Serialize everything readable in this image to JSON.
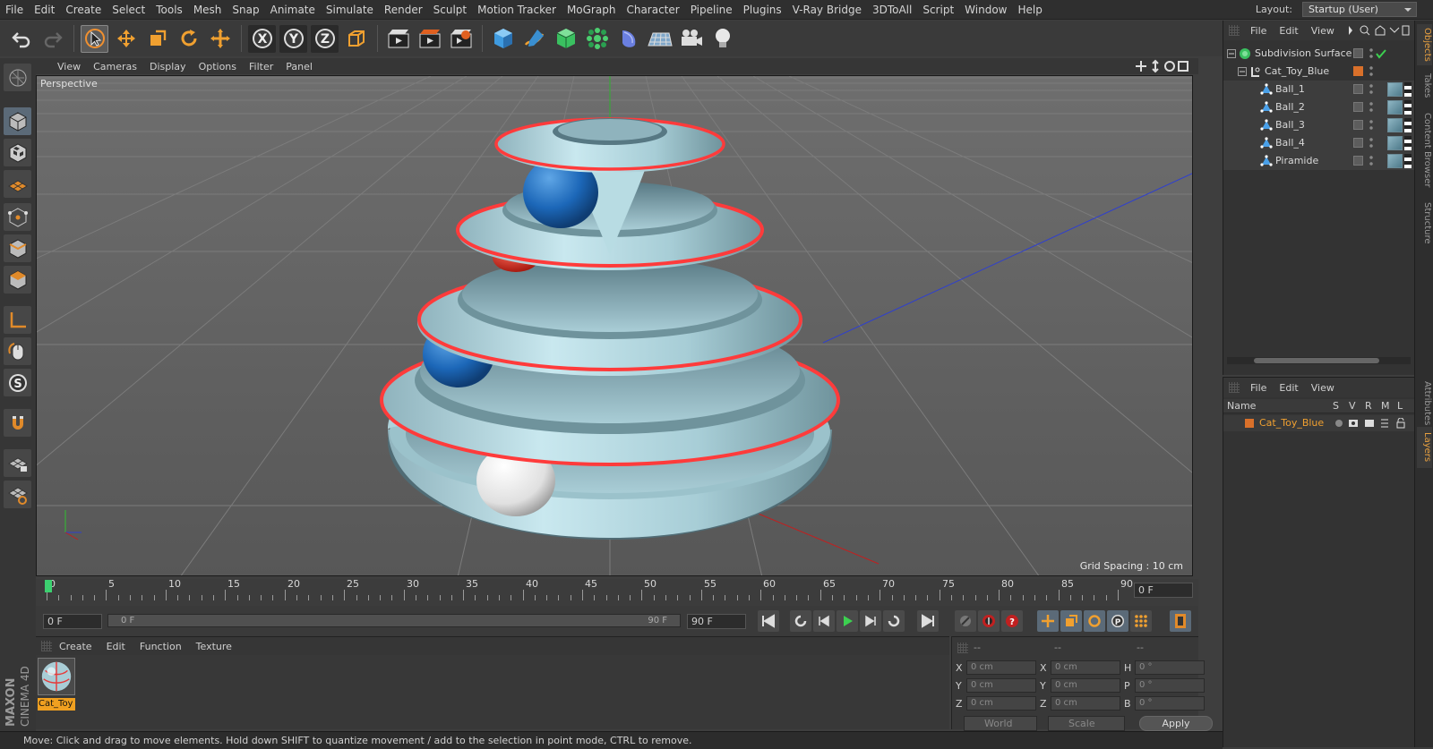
{
  "menubar": {
    "items": [
      "File",
      "Edit",
      "Create",
      "Select",
      "Tools",
      "Mesh",
      "Snap",
      "Animate",
      "Simulate",
      "Render",
      "Sculpt",
      "Motion Tracker",
      "MoGraph",
      "Character",
      "Pipeline",
      "Plugins",
      "V-Ray Bridge",
      "3DToAll",
      "Script",
      "Window",
      "Help"
    ],
    "layout_label": "Layout:",
    "layout_value": "Startup (User)"
  },
  "viewport": {
    "menu": [
      "View",
      "Cameras",
      "Display",
      "Options",
      "Filter",
      "Panel"
    ],
    "label": "Perspective",
    "grid_spacing": "Grid Spacing : 10 cm"
  },
  "timeline": {
    "ticks": [
      "0",
      "5",
      "10",
      "15",
      "20",
      "25",
      "30",
      "35",
      "40",
      "45",
      "50",
      "55",
      "60",
      "65",
      "70",
      "75",
      "80",
      "85",
      "90"
    ],
    "current_frame": "0 F",
    "start_field": "0 F",
    "slider_left": "0 F",
    "slider_right": "90 F",
    "end_field": "90 F"
  },
  "material_manager": {
    "menu": [
      "Create",
      "Edit",
      "Function",
      "Texture"
    ],
    "material_name": "Cat_Toy"
  },
  "coordinates": {
    "header_dashes": [
      "--",
      "--",
      "--"
    ],
    "rows": [
      {
        "a": "X",
        "av": "0 cm",
        "b": "X",
        "bv": "0 cm",
        "c": "H",
        "cv": "0 °"
      },
      {
        "a": "Y",
        "av": "0 cm",
        "b": "Y",
        "bv": "0 cm",
        "c": "P",
        "cv": "0 °"
      },
      {
        "a": "Z",
        "av": "0 cm",
        "b": "Z",
        "bv": "0 cm",
        "c": "B",
        "cv": "0 °"
      }
    ],
    "mode": "World",
    "scale": "Scale",
    "apply": "Apply"
  },
  "status": "Move: Click and drag to move elements. Hold down SHIFT to quantize movement / add to the selection in point mode, CTRL to remove.",
  "objects": {
    "menu": [
      "File",
      "Edit",
      "View"
    ],
    "items": [
      {
        "name": "Subdivision Surface",
        "indent": 0
      },
      {
        "name": "Cat_Toy_Blue",
        "indent": 1
      },
      {
        "name": "Ball_1",
        "indent": 2
      },
      {
        "name": "Ball_2",
        "indent": 2
      },
      {
        "name": "Ball_3",
        "indent": 2
      },
      {
        "name": "Ball_4",
        "indent": 2
      },
      {
        "name": "Piramide",
        "indent": 2
      }
    ]
  },
  "layers": {
    "menu": [
      "File",
      "Edit",
      "View"
    ],
    "headers": [
      "Name",
      "S",
      "V",
      "R",
      "M",
      "L"
    ],
    "layer_name": "Cat_Toy_Blue",
    "layer_color": "#d9702a"
  },
  "side_tabs": [
    "Objects",
    "Takes",
    "Content Browser",
    "Structure",
    "Attributes",
    "Layers"
  ],
  "brand": {
    "top": "MAXON",
    "bottom": "CINEMA 4D"
  }
}
